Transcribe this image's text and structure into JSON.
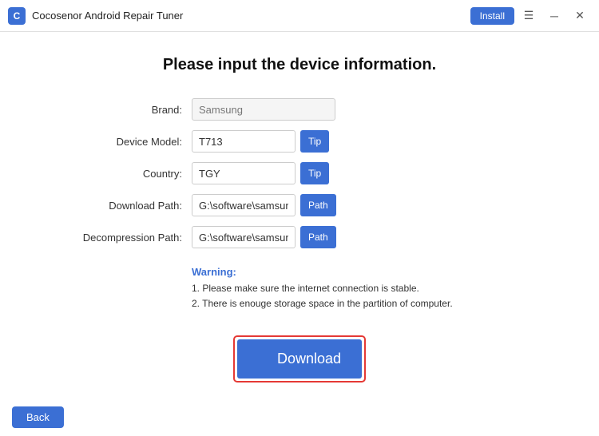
{
  "titleBar": {
    "appName": "Cocosenor Android Repair Tuner",
    "installLabel": "Install",
    "hamburgerIcon": "☰",
    "minimizeIcon": "─",
    "closeIcon": "✕"
  },
  "main": {
    "pageTitle": "Please input the device information.",
    "form": {
      "brandLabel": "Brand:",
      "brandValue": "Samsung",
      "modelLabel": "Device Model:",
      "modelValue": "T713",
      "tipLabel1": "Tip",
      "countryLabel": "Country:",
      "countryValue": "TGY",
      "tipLabel2": "Tip",
      "downloadPathLabel": "Download Path:",
      "downloadPathValue": "G:\\software\\samsung\\Downlo",
      "pathLabel1": "Path",
      "decompressionPathLabel": "Decompression Path:",
      "decompressionPathValue": "G:\\software\\samsung\\Firmwai",
      "pathLabel2": "Path"
    },
    "warning": {
      "title": "Warning:",
      "item1": "1. Please make sure the internet connection is stable.",
      "item2": "2. There is enouge storage space in the partition of computer."
    },
    "downloadButton": "Download"
  },
  "footer": {
    "backLabel": "Back"
  }
}
